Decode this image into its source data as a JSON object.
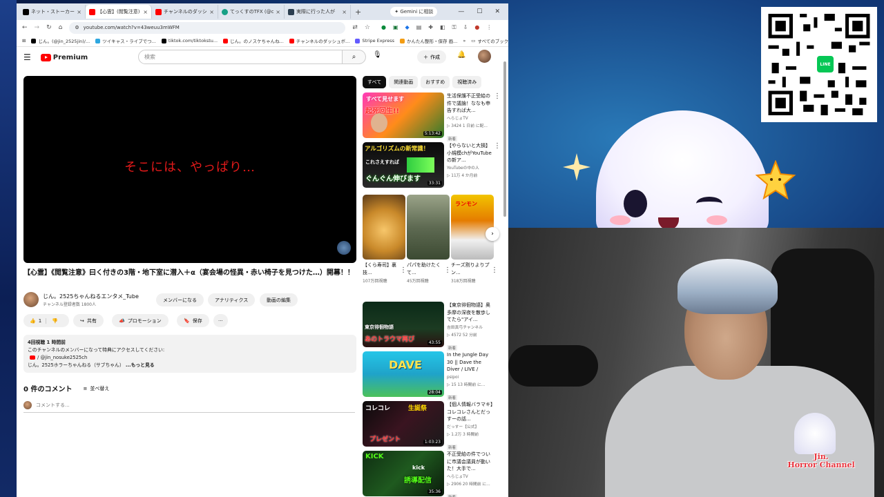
{
  "tabs": [
    {
      "label": "ネット・ストーカーを考え",
      "color": "#000000"
    },
    {
      "label": "【心霊】(閲覧注意)",
      "color": "#ff0000",
      "active": true
    },
    {
      "label": "チャンネルのダッシュボ",
      "color": "#ff0000"
    },
    {
      "label": "てっくすのTFX (@c...",
      "color": "#16a085"
    },
    {
      "label": "実際に行った人が",
      "color": "#2c3e50"
    }
  ],
  "gemini_label": "Gemini に相談",
  "url": "youtube.com/watch?v=43weuu3mWFM",
  "bookmarks": [
    {
      "label": "じん。(@jin_2525jin)/...",
      "color": "#000000"
    },
    {
      "label": "ツイキャス・ライブでつ...",
      "color": "#2ea7e0"
    },
    {
      "label": "tiktok.com/tiktokstu...",
      "color": "#000000"
    },
    {
      "label": "じん。のノスケちゃんね...",
      "color": "#ff0000"
    },
    {
      "label": "チャンネルのダッシュボ...",
      "color": "#ff0000"
    },
    {
      "label": "Stripe Express",
      "color": "#635bff"
    },
    {
      "label": "かんたん整形・保存 画...",
      "color": "#f39c12"
    }
  ],
  "bookmarks_all": "すべてのブックマーク",
  "yt": {
    "logo_text": "Premium",
    "search_placeholder": "検索",
    "create_label": "作成"
  },
  "video": {
    "subtitle": "そこには、やっぱり…",
    "title": "【心霊】《閲覧注意》曰く付きの3階・地下室に潜入＋α（宴会場の怪異・赤い椅子を見つけた…）開幕！！",
    "channel_name": "じん。2525ちゃんねるエンタメ_Tube",
    "subscribers": "チャンネル登録者数 1800人",
    "buttons": {
      "member": "メンバーになる",
      "analytics": "アナリティクス",
      "edit": "動画の編集",
      "like_count": "1",
      "share": "共有",
      "promote": "プロモーション",
      "save": "保存"
    },
    "desc_stats": "4回視聴  1 時間前",
    "desc_line1": "このチャンネルのメンバーになって特典にアクセスしてください:",
    "desc_link": "/ @jin_nosuke2525ch",
    "desc_line3": "じん。2525ホラーちゃんねる（サブちゃん）",
    "desc_more": "...もっと見る",
    "comments_count": "0 件のコメント",
    "sort_label": "並べ替え",
    "comment_placeholder": "コメントする..."
  },
  "chips": [
    "すべて",
    "関連動画",
    "おすすめ",
    "視聴済み"
  ],
  "recs": [
    {
      "title": "生活保護不正受給の件で議論！ななも申告すれば大...",
      "channel": "へらじょTV",
      "meta": "▷ 3424  1 日前 に配...",
      "badge": "新着",
      "dur": "5:13:42"
    },
    {
      "title": "【やらないと大損】小規模chがYouTubeの新ア...",
      "channel": "YouTubeの中の人",
      "meta": "▷ 11万  4 か月前",
      "badge": "",
      "dur": "33:31"
    },
    {
      "title": "【東京徘徊物語】奥多摩の深夜を散歩してたら\"アイ...",
      "channel": "吉田真弓チャンネル",
      "meta": "▷ 4572  52 分前",
      "badge": "新着",
      "dur": "43:55"
    },
    {
      "title": "In the Jungle Day 30 || Dave the Diver / LIVE /",
      "channel": "psipoi",
      "meta": "▷ 15  13 時間前 に...",
      "badge": "新着",
      "dur": "28:04"
    },
    {
      "title": "【個人情報バラマキ】コレコレさんとだっすーの話...",
      "channel": "だっすー【公式】",
      "meta": "▷ 1.2万  3 時間前",
      "badge": "新着",
      "dur": "1:03:23"
    },
    {
      "title": "不正受給の件でついに市議会議員が動いた！大手で...",
      "channel": "へらじょTV",
      "meta": "▷ 2906  20 時間前 に...",
      "badge": "新着",
      "dur": "35:36"
    }
  ],
  "thumb_text": {
    "r0a": "すべて見せます",
    "r0b": "起死回生!!",
    "r1a": "アルゴリズムの新常識！",
    "r1b": "これさえすれば",
    "r1c": "ぐんぐん伸びます",
    "r2a": "東京徘徊物語",
    "r2b": "あのトラウマ再び",
    "r3a": "DAVE",
    "r4a": "コレコレ",
    "r4b": "生誕祭",
    "r4c": "プレゼント",
    "r5a": "KICK",
    "r5b": "kick",
    "r5c": "誘導配信"
  },
  "shorts": [
    {
      "title": "【くら寿司】裏技...",
      "views": "107万回視聴"
    },
    {
      "title": "パパを助けたくて...",
      "views": "45万回視聴"
    },
    {
      "title": "チーズ割りよりプン...",
      "views": "318万回視聴"
    }
  ],
  "shorts_thumb_text": "ランモン",
  "overlay": {
    "line_label": "LINE",
    "channel_logo": "Jin.\nHorror Channel"
  },
  "colors": {
    "yt_red": "#ff0000",
    "subtitle_red": "#e31a1a",
    "line_green": "#06c755"
  }
}
